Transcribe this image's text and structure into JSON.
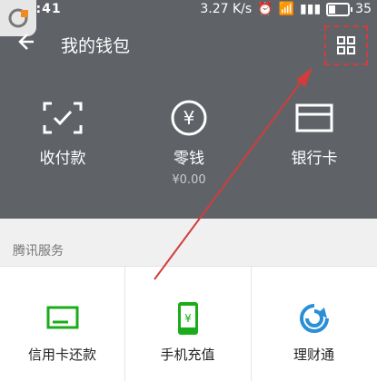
{
  "status": {
    "time": "18:41",
    "network_speed": "3.27 K/s",
    "battery_percent": "35"
  },
  "header": {
    "title": "我的钱包"
  },
  "top_actions": [
    {
      "label": "收付款",
      "icon": "qr-scan-icon"
    },
    {
      "label": "零钱",
      "sub": "¥0.00",
      "icon": "yen-circle-icon"
    },
    {
      "label": "银行卡",
      "icon": "bank-card-icon"
    }
  ],
  "section": {
    "title": "腾讯服务"
  },
  "services": [
    {
      "label": "信用卡还款",
      "icon": "credit-card-repay-icon"
    },
    {
      "label": "手机充值",
      "icon": "phone-recharge-icon"
    },
    {
      "label": "理财通",
      "icon": "wealth-icon"
    }
  ],
  "colors": {
    "header_bg": "#5f6368",
    "accent_green": "#1aad19",
    "annotation_red": "#d23c3c"
  }
}
